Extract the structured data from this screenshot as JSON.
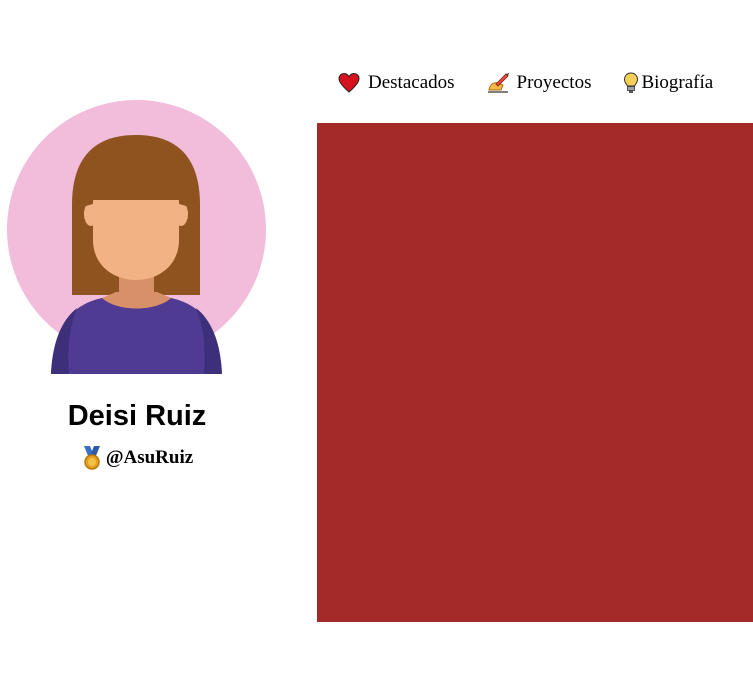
{
  "profile": {
    "name": "Deisi Ruiz",
    "handle": "@AsuRuiz",
    "avatar_icon": "avatar-woman-icon",
    "handle_icon": "medal-icon"
  },
  "nav": {
    "items": [
      {
        "label": "Destacados",
        "icon": "heart-icon"
      },
      {
        "label": "Proyectos",
        "icon": "writing-hand-icon"
      },
      {
        "label": "Biografía",
        "icon": "lightbulb-icon"
      }
    ]
  },
  "colors": {
    "panel": "#a42a2a",
    "avatar_bg": "#f2bcdb",
    "hair": "#8e531f",
    "skin": "#f3b283",
    "shirt": "#4f3b92"
  }
}
